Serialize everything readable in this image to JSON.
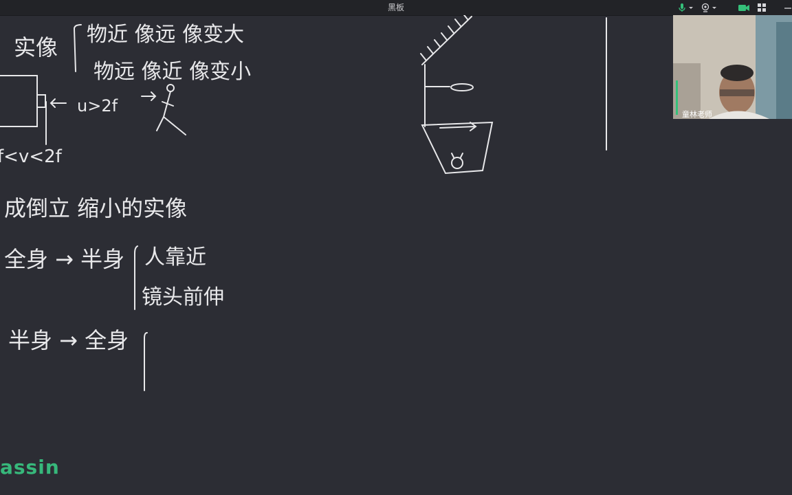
{
  "window": {
    "title": "黑板"
  },
  "toolbar": {
    "icons": [
      "microphone-icon",
      "chevron-down-icon",
      "camera-icon",
      "chevron-down-icon",
      "video-call-icon",
      "grid-layout-icon",
      "minimize-icon"
    ],
    "accent_color": "#35c07a"
  },
  "video": {
    "name": "童林老师"
  },
  "brand": {
    "logo_text": "assin",
    "color": "#37b87b"
  },
  "board": {
    "background": "#2c2d34",
    "ink_color": "#e8e8ea",
    "handwriting": [
      "实像",
      "物近 像远 像变大",
      "物远 像近 像变小",
      "u>2f",
      "f<v<2f",
      "成倒立 缩小的实像",
      "全身 → 半身",
      "人靠近",
      "镜头前伸",
      "半身 → 全身"
    ]
  }
}
